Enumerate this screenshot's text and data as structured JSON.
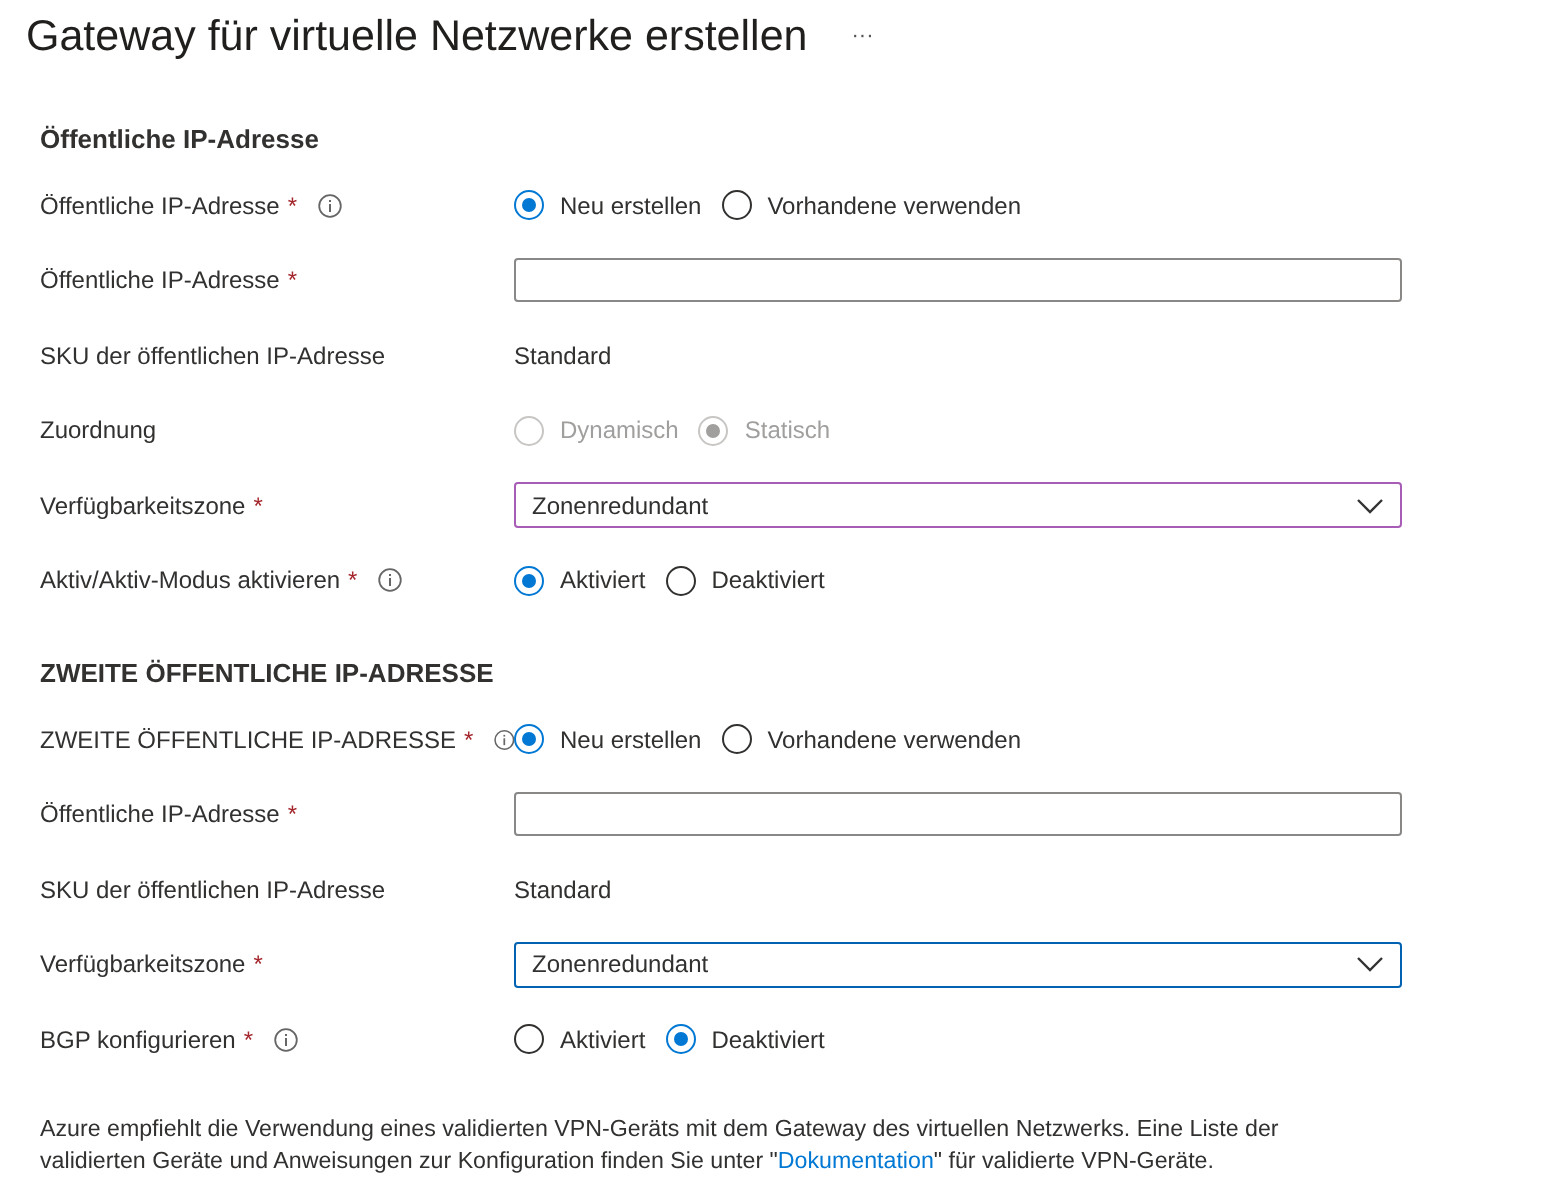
{
  "title": "Gateway für virtuelle Netzwerke erstellen",
  "more": "···",
  "sections": [
    {
      "heading": "Öffentliche IP-Adresse",
      "rows": [
        {
          "kind": "radio",
          "label": "Öffentliche IP-Adresse",
          "required": "*",
          "info": true,
          "disabled": false,
          "options": [
            {
              "label": "Neu erstellen",
              "selected": true
            },
            {
              "label": "Vorhandene verwenden",
              "selected": false
            }
          ]
        },
        {
          "kind": "text",
          "label": "Öffentliche IP-Adresse",
          "required": "*",
          "info": false
        },
        {
          "kind": "static",
          "label": "SKU der öffentlichen IP-Adresse",
          "info": false,
          "value": "Standard"
        },
        {
          "kind": "radio",
          "label": "Zuordnung",
          "info": false,
          "disabled": true,
          "options": [
            {
              "label": "Dynamisch",
              "selected": false
            },
            {
              "label": "Statisch",
              "selected": true
            }
          ]
        },
        {
          "kind": "dropdown",
          "label": "Verfügbarkeitszone",
          "required": "*",
          "info": false,
          "value": "Zonenredundant",
          "focused": false
        },
        {
          "kind": "radio",
          "label": "Aktiv/Aktiv-Modus aktivieren",
          "required": "*",
          "info": true,
          "disabled": false,
          "options": [
            {
              "label": "Aktiviert",
              "selected": true
            },
            {
              "label": "Deaktiviert",
              "selected": false
            }
          ]
        }
      ]
    },
    {
      "heading": "ZWEITE ÖFFENTLICHE IP-ADRESSE",
      "rows": [
        {
          "kind": "radio",
          "label": "ZWEITE ÖFFENTLICHE IP-ADRESSE",
          "required": "*",
          "info": true,
          "disabled": false,
          "options": [
            {
              "label": "Neu erstellen",
              "selected": true
            },
            {
              "label": "Vorhandene verwenden",
              "selected": false
            }
          ]
        },
        {
          "kind": "text",
          "label": "Öffentliche IP-Adresse",
          "required": "*",
          "info": false
        },
        {
          "kind": "static",
          "label": "SKU der öffentlichen IP-Adresse",
          "info": false,
          "value": "Standard"
        },
        {
          "kind": "dropdown",
          "label": "Verfügbarkeitszone",
          "required": "*",
          "info": false,
          "value": "Zonenredundant",
          "focused": true
        },
        {
          "kind": "radio",
          "label": "BGP konfigurieren",
          "required": "*",
          "info": true,
          "disabled": false,
          "options": [
            {
              "label": "Aktiviert",
              "selected": false
            },
            {
              "label": "Deaktiviert",
              "selected": true
            }
          ]
        }
      ]
    }
  ],
  "note": {
    "before": "Azure empfiehlt die Verwendung eines validierten VPN-Geräts mit dem Gateway des virtuellen Netzwerks. Eine Liste der validierten Geräte und Anweisungen zur Konfiguration finden Sie unter \"",
    "link": "Dokumentation",
    "after": "\" für validierte VPN-Geräte."
  }
}
